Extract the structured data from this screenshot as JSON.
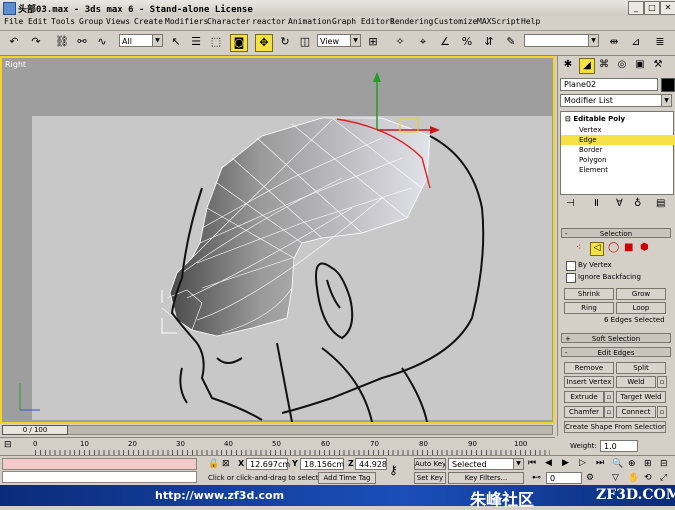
{
  "window": {
    "title": "头部03.max - 3ds max 6 - Stand-alone License"
  },
  "menu": [
    "File",
    "Edit",
    "Tools",
    "Group",
    "Views",
    "Create",
    "Modifiers",
    "Character",
    "reactor",
    "Animation",
    "Graph Editors",
    "Rendering",
    "Customize",
    "MAXScript",
    "Help"
  ],
  "toolbar": {
    "selection_filter": "All",
    "ref_coord": "View"
  },
  "viewport": {
    "label": "Right"
  },
  "command_panel": {
    "object_name": "Plane02",
    "modifier_list": "Modifier List",
    "stack": {
      "root": "Editable Poly",
      "items": [
        "Vertex",
        "Edge",
        "Border",
        "Polygon",
        "Element"
      ],
      "selected": "Edge"
    },
    "selection": {
      "header": "Selection",
      "by_vertex": "By Vertex",
      "ignore_backfacing": "Ignore Backfacing",
      "shrink": "Shrink",
      "grow": "Grow",
      "ring": "Ring",
      "loop": "Loop",
      "status": "6 Edges Selected"
    },
    "soft_selection": "Soft Selection",
    "edit_edges": {
      "header": "Edit Edges",
      "remove": "Remove",
      "split": "Split",
      "insert_vertex": "Insert Vertex",
      "weld": "Weld",
      "extrude": "Extrude",
      "target_weld": "Target Weld",
      "chamfer": "Chamfer",
      "connect": "Connect",
      "create_shape": "Create Shape From Selection",
      "weight_label": "Weight:",
      "weight_value": "1.0"
    }
  },
  "time": {
    "slider": "0 / 100",
    "ticks": [
      "0",
      "10",
      "20",
      "30",
      "40",
      "50",
      "60",
      "70",
      "80",
      "90",
      "100"
    ]
  },
  "status": {
    "x": "12.697cm",
    "y": "18.156cm",
    "z": "44.928cm",
    "x_label": "X",
    "y_label": "Y",
    "z_label": "Z",
    "prompt": "Click or click-and-drag to select ob",
    "add_time_tag": "Add Time Tag",
    "auto_key": "Auto Key",
    "set_key": "Set Key",
    "key_mode": "Selected",
    "key_filters": "Key Filters...",
    "frame": "0"
  },
  "watermark": {
    "url": "http://www.zf3d.com",
    "cn": "朱峰社区",
    "brand": "ZF3D.COM"
  },
  "colors": {
    "viewport_border": "#f2d428",
    "selection_highlight": "#f5e046",
    "watermark_bg": "#1a4fb8"
  }
}
